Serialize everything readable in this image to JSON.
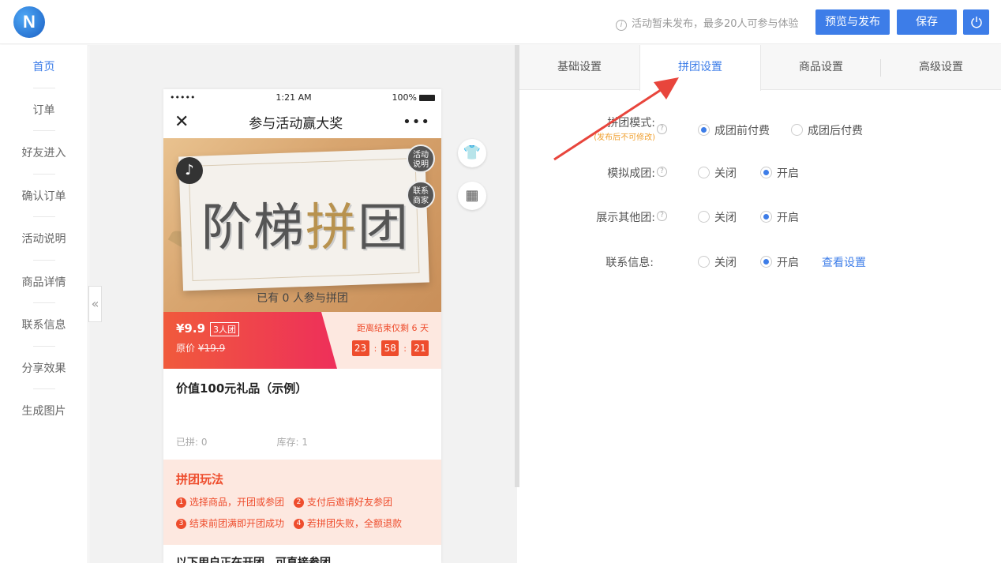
{
  "topbar": {
    "logo_letter": "N",
    "notice": "活动暂未发布，最多20人可参与体验",
    "publish_label": "预览与发布",
    "save_label": "保存",
    "power_icon": "power-icon"
  },
  "nav": {
    "items": [
      {
        "label": "首页",
        "active": true
      },
      {
        "label": "订单"
      },
      {
        "label": "好友进入"
      },
      {
        "label": "确认订单"
      },
      {
        "label": "活动说明"
      },
      {
        "label": "商品详情"
      },
      {
        "label": "联系信息"
      },
      {
        "label": "分享效果"
      },
      {
        "label": "生成图片"
      }
    ],
    "collapse_icon": "«"
  },
  "phone": {
    "status": {
      "signal": "•••••",
      "time": "1:21 AM",
      "battery": "100%"
    },
    "title": "参与活动赢大奖",
    "more": "•••",
    "banner": {
      "t1": "阶梯",
      "t2": "拼",
      "t3": "团",
      "badge1": [
        "活动",
        "说明"
      ],
      "badge2": [
        "联系",
        "商家"
      ],
      "joined": "已有 0 人参与拼团"
    },
    "price": {
      "current": "¥9.9",
      "group_tag": "3人团",
      "original_label": "原价",
      "original": "¥19.9",
      "countdown_label": "距离结束仅剩 6 天",
      "h": "23",
      "m": "58",
      "s": "21"
    },
    "product": {
      "name": "价值100元礼品（示例）",
      "sold": "已拼: 0",
      "stock": "库存: 1"
    },
    "rules": {
      "title": "拼团玩法",
      "r1": "选择商品，开团或参团",
      "r2": "支付后邀请好友参团",
      "r3": "结束前团满即开团成功",
      "r4": "若拼团失败，全额退款"
    },
    "bottom": "以下用户正在开团，可直接参团"
  },
  "panel": {
    "tabs": [
      "基础设置",
      "拼团设置",
      "商品设置",
      "高级设置"
    ],
    "active_tab": 1,
    "rows": [
      {
        "label": "拼团模式:",
        "sub": "(发布后不可修改)",
        "opt1": "成团前付费",
        "opt2": "成团后付费",
        "selected": 1
      },
      {
        "label": "模拟成团:",
        "opt1": "关闭",
        "opt2": "开启",
        "selected": 2
      },
      {
        "label": "展示其他团:",
        "opt1": "关闭",
        "opt2": "开启",
        "selected": 2
      },
      {
        "label": "联系信息:",
        "opt1": "关闭",
        "opt2": "开启",
        "selected": 2,
        "link": "查看设置"
      }
    ]
  },
  "colors": {
    "accent": "#3d7de8",
    "promo": "#ee4d2d",
    "arrow": "#e8453c"
  }
}
